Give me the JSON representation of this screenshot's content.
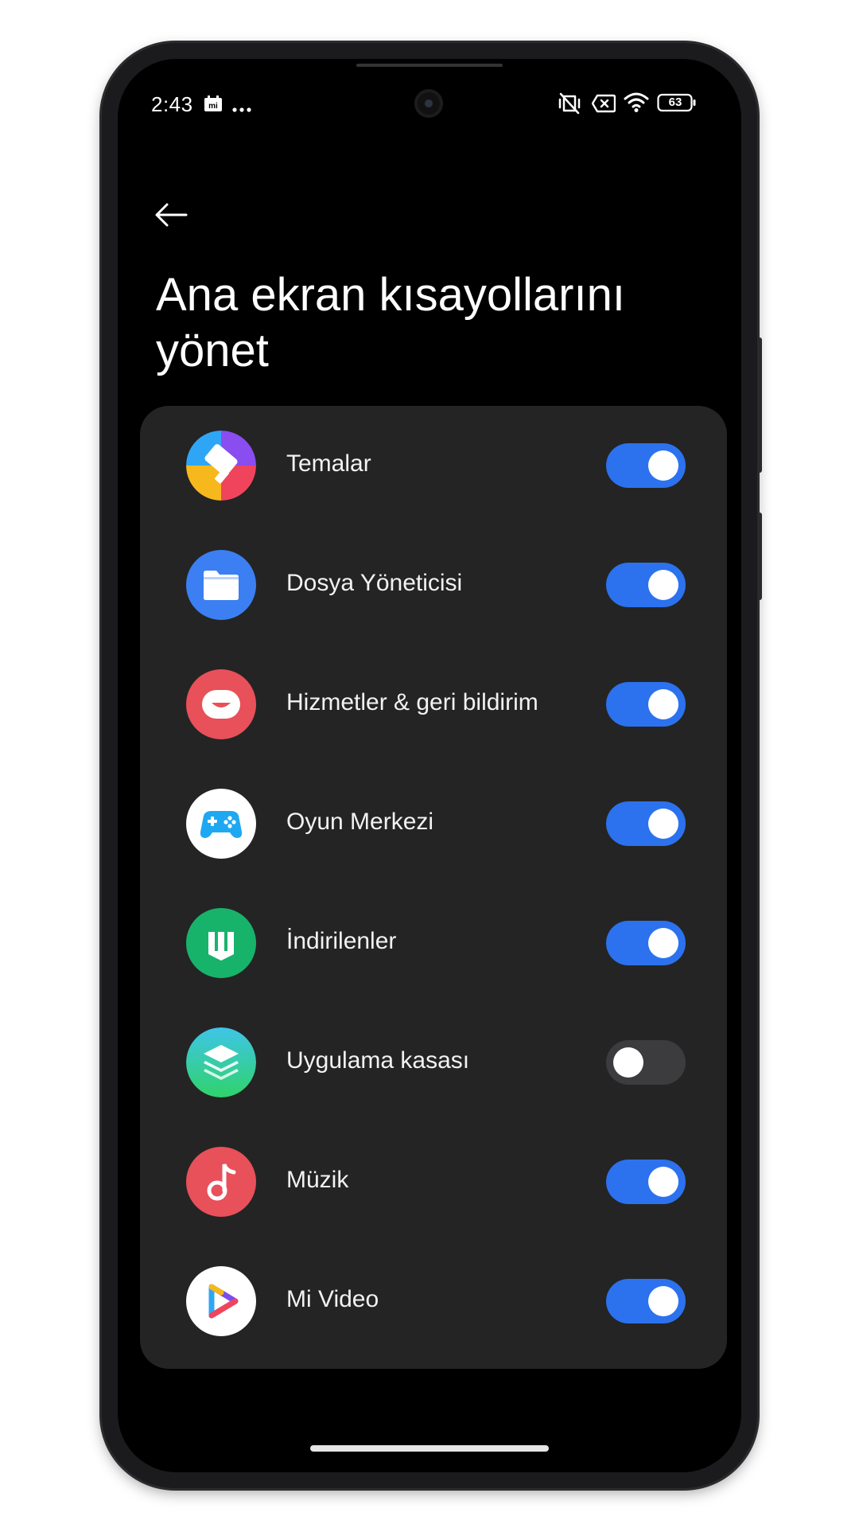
{
  "status_bar": {
    "time": "2:43",
    "battery": "63",
    "left_icons": [
      "mi-notification-icon",
      "more-dots-icon"
    ],
    "right_icons": [
      "vibrate-off-icon",
      "sim-off-icon",
      "wifi-icon",
      "battery-icon"
    ]
  },
  "header": {
    "back_icon": "arrow-left-icon",
    "title": "Ana ekran kısayollarını yönet"
  },
  "shortcuts": [
    {
      "label": "Temalar",
      "icon": "themes-icon",
      "enabled": true
    },
    {
      "label": "Dosya Yöneticisi",
      "icon": "folder-icon",
      "enabled": true
    },
    {
      "label": "Hizmetler & geri bildirim",
      "icon": "feedback-icon",
      "enabled": true
    },
    {
      "label": "Oyun Merkezi",
      "icon": "gamepad-icon",
      "enabled": true
    },
    {
      "label": "İndirilenler",
      "icon": "downloads-icon",
      "enabled": true
    },
    {
      "label": "Uygulama kasası",
      "icon": "app-vault-icon",
      "enabled": false
    },
    {
      "label": "Müzik",
      "icon": "music-icon",
      "enabled": true
    },
    {
      "label": "Mi Video",
      "icon": "mi-video-icon",
      "enabled": true
    }
  ],
  "colors": {
    "toggle_on": "#2c72ee",
    "toggle_off": "#3c3c3e",
    "card_bg": "#242424",
    "screen_bg": "#000000"
  }
}
